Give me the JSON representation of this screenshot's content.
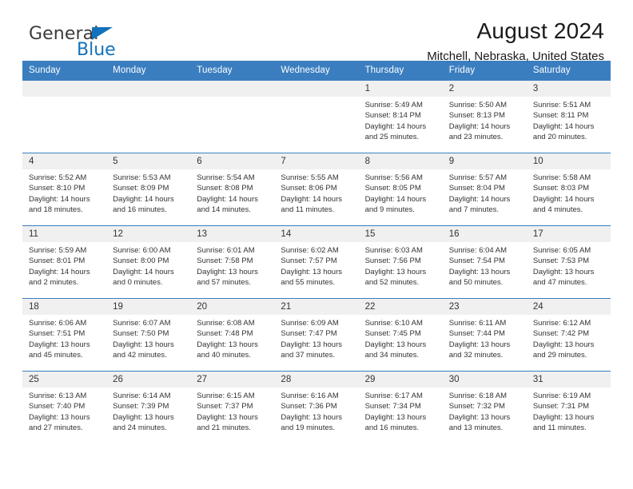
{
  "brand": {
    "name_top": "General",
    "name_bottom": "Blue",
    "triangle_color": "#1272bb"
  },
  "header": {
    "title": "August 2024",
    "subtitle": "Mitchell, Nebraska, United States"
  },
  "calendar": {
    "header_bg": "#3a7ec0",
    "daynum_bg": "#f0f0f0",
    "weekday_labels": [
      "Sunday",
      "Monday",
      "Tuesday",
      "Wednesday",
      "Thursday",
      "Friday",
      "Saturday"
    ],
    "weeks": [
      [
        {
          "day": "",
          "sunrise": "",
          "sunset": "",
          "daylight": ""
        },
        {
          "day": "",
          "sunrise": "",
          "sunset": "",
          "daylight": ""
        },
        {
          "day": "",
          "sunrise": "",
          "sunset": "",
          "daylight": ""
        },
        {
          "day": "",
          "sunrise": "",
          "sunset": "",
          "daylight": ""
        },
        {
          "day": "1",
          "sunrise": "Sunrise: 5:49 AM",
          "sunset": "Sunset: 8:14 PM",
          "daylight": "Daylight: 14 hours and 25 minutes."
        },
        {
          "day": "2",
          "sunrise": "Sunrise: 5:50 AM",
          "sunset": "Sunset: 8:13 PM",
          "daylight": "Daylight: 14 hours and 23 minutes."
        },
        {
          "day": "3",
          "sunrise": "Sunrise: 5:51 AM",
          "sunset": "Sunset: 8:11 PM",
          "daylight": "Daylight: 14 hours and 20 minutes."
        }
      ],
      [
        {
          "day": "4",
          "sunrise": "Sunrise: 5:52 AM",
          "sunset": "Sunset: 8:10 PM",
          "daylight": "Daylight: 14 hours and 18 minutes."
        },
        {
          "day": "5",
          "sunrise": "Sunrise: 5:53 AM",
          "sunset": "Sunset: 8:09 PM",
          "daylight": "Daylight: 14 hours and 16 minutes."
        },
        {
          "day": "6",
          "sunrise": "Sunrise: 5:54 AM",
          "sunset": "Sunset: 8:08 PM",
          "daylight": "Daylight: 14 hours and 14 minutes."
        },
        {
          "day": "7",
          "sunrise": "Sunrise: 5:55 AM",
          "sunset": "Sunset: 8:06 PM",
          "daylight": "Daylight: 14 hours and 11 minutes."
        },
        {
          "day": "8",
          "sunrise": "Sunrise: 5:56 AM",
          "sunset": "Sunset: 8:05 PM",
          "daylight": "Daylight: 14 hours and 9 minutes."
        },
        {
          "day": "9",
          "sunrise": "Sunrise: 5:57 AM",
          "sunset": "Sunset: 8:04 PM",
          "daylight": "Daylight: 14 hours and 7 minutes."
        },
        {
          "day": "10",
          "sunrise": "Sunrise: 5:58 AM",
          "sunset": "Sunset: 8:03 PM",
          "daylight": "Daylight: 14 hours and 4 minutes."
        }
      ],
      [
        {
          "day": "11",
          "sunrise": "Sunrise: 5:59 AM",
          "sunset": "Sunset: 8:01 PM",
          "daylight": "Daylight: 14 hours and 2 minutes."
        },
        {
          "day": "12",
          "sunrise": "Sunrise: 6:00 AM",
          "sunset": "Sunset: 8:00 PM",
          "daylight": "Daylight: 14 hours and 0 minutes."
        },
        {
          "day": "13",
          "sunrise": "Sunrise: 6:01 AM",
          "sunset": "Sunset: 7:58 PM",
          "daylight": "Daylight: 13 hours and 57 minutes."
        },
        {
          "day": "14",
          "sunrise": "Sunrise: 6:02 AM",
          "sunset": "Sunset: 7:57 PM",
          "daylight": "Daylight: 13 hours and 55 minutes."
        },
        {
          "day": "15",
          "sunrise": "Sunrise: 6:03 AM",
          "sunset": "Sunset: 7:56 PM",
          "daylight": "Daylight: 13 hours and 52 minutes."
        },
        {
          "day": "16",
          "sunrise": "Sunrise: 6:04 AM",
          "sunset": "Sunset: 7:54 PM",
          "daylight": "Daylight: 13 hours and 50 minutes."
        },
        {
          "day": "17",
          "sunrise": "Sunrise: 6:05 AM",
          "sunset": "Sunset: 7:53 PM",
          "daylight": "Daylight: 13 hours and 47 minutes."
        }
      ],
      [
        {
          "day": "18",
          "sunrise": "Sunrise: 6:06 AM",
          "sunset": "Sunset: 7:51 PM",
          "daylight": "Daylight: 13 hours and 45 minutes."
        },
        {
          "day": "19",
          "sunrise": "Sunrise: 6:07 AM",
          "sunset": "Sunset: 7:50 PM",
          "daylight": "Daylight: 13 hours and 42 minutes."
        },
        {
          "day": "20",
          "sunrise": "Sunrise: 6:08 AM",
          "sunset": "Sunset: 7:48 PM",
          "daylight": "Daylight: 13 hours and 40 minutes."
        },
        {
          "day": "21",
          "sunrise": "Sunrise: 6:09 AM",
          "sunset": "Sunset: 7:47 PM",
          "daylight": "Daylight: 13 hours and 37 minutes."
        },
        {
          "day": "22",
          "sunrise": "Sunrise: 6:10 AM",
          "sunset": "Sunset: 7:45 PM",
          "daylight": "Daylight: 13 hours and 34 minutes."
        },
        {
          "day": "23",
          "sunrise": "Sunrise: 6:11 AM",
          "sunset": "Sunset: 7:44 PM",
          "daylight": "Daylight: 13 hours and 32 minutes."
        },
        {
          "day": "24",
          "sunrise": "Sunrise: 6:12 AM",
          "sunset": "Sunset: 7:42 PM",
          "daylight": "Daylight: 13 hours and 29 minutes."
        }
      ],
      [
        {
          "day": "25",
          "sunrise": "Sunrise: 6:13 AM",
          "sunset": "Sunset: 7:40 PM",
          "daylight": "Daylight: 13 hours and 27 minutes."
        },
        {
          "day": "26",
          "sunrise": "Sunrise: 6:14 AM",
          "sunset": "Sunset: 7:39 PM",
          "daylight": "Daylight: 13 hours and 24 minutes."
        },
        {
          "day": "27",
          "sunrise": "Sunrise: 6:15 AM",
          "sunset": "Sunset: 7:37 PM",
          "daylight": "Daylight: 13 hours and 21 minutes."
        },
        {
          "day": "28",
          "sunrise": "Sunrise: 6:16 AM",
          "sunset": "Sunset: 7:36 PM",
          "daylight": "Daylight: 13 hours and 19 minutes."
        },
        {
          "day": "29",
          "sunrise": "Sunrise: 6:17 AM",
          "sunset": "Sunset: 7:34 PM",
          "daylight": "Daylight: 13 hours and 16 minutes."
        },
        {
          "day": "30",
          "sunrise": "Sunrise: 6:18 AM",
          "sunset": "Sunset: 7:32 PM",
          "daylight": "Daylight: 13 hours and 13 minutes."
        },
        {
          "day": "31",
          "sunrise": "Sunrise: 6:19 AM",
          "sunset": "Sunset: 7:31 PM",
          "daylight": "Daylight: 13 hours and 11 minutes."
        }
      ]
    ]
  }
}
